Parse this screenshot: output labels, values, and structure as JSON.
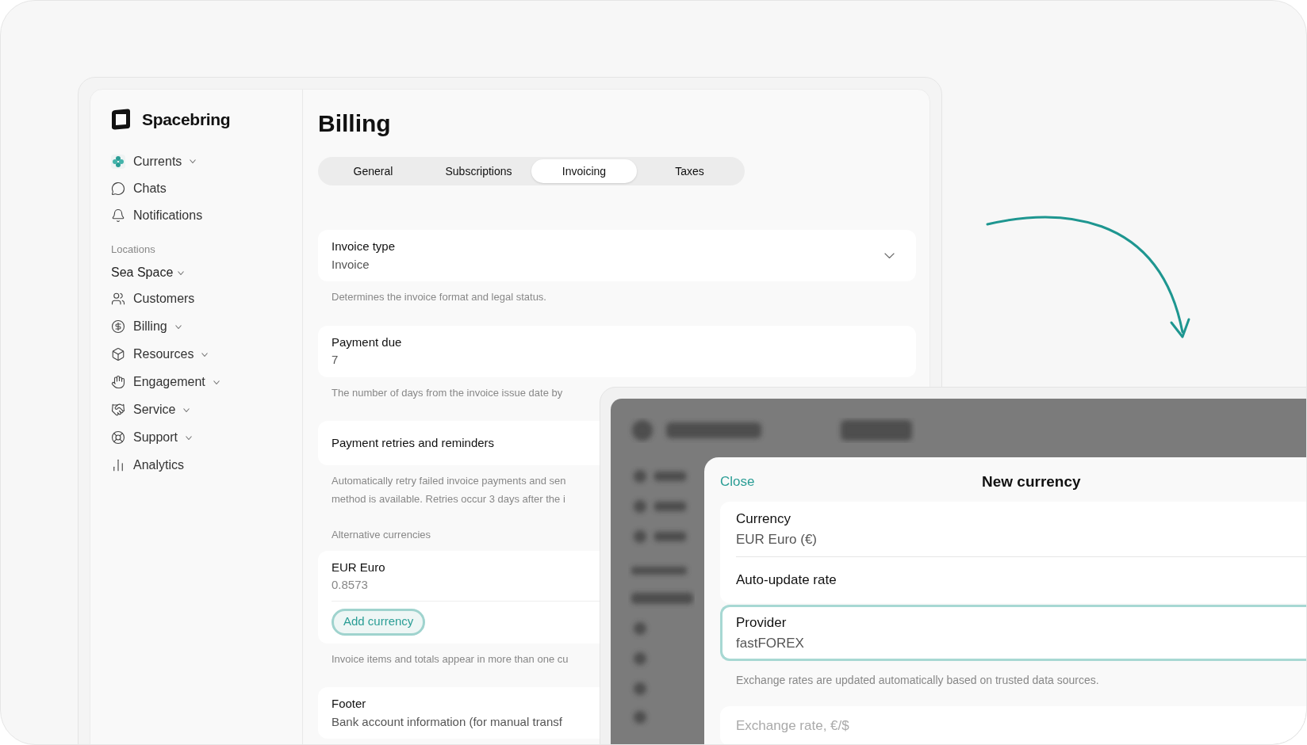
{
  "sidebar": {
    "brand": "Spacebring",
    "top_items": [
      {
        "label": "Currents",
        "dropdown": true
      },
      {
        "label": "Chats",
        "dropdown": false
      },
      {
        "label": "Notifications",
        "dropdown": false
      }
    ],
    "section_label": "Locations",
    "location": {
      "label": "Sea Space",
      "dropdown": true
    },
    "items": [
      {
        "label": "Customers",
        "dropdown": false
      },
      {
        "label": "Billing",
        "dropdown": true
      },
      {
        "label": "Resources",
        "dropdown": true
      },
      {
        "label": "Engagement",
        "dropdown": true
      },
      {
        "label": "Service",
        "dropdown": true
      },
      {
        "label": "Support",
        "dropdown": true
      },
      {
        "label": "Analytics",
        "dropdown": false
      }
    ]
  },
  "page_title": "Billing",
  "tabs": [
    {
      "label": "General",
      "selected": false
    },
    {
      "label": "Subscriptions",
      "selected": false
    },
    {
      "label": "Invoicing",
      "selected": true
    },
    {
      "label": "Taxes",
      "selected": false
    }
  ],
  "sections": [
    {
      "kind": "select",
      "label": "Invoice type",
      "value": "Invoice",
      "description": [
        "Determines the invoice format and legal status."
      ]
    },
    {
      "kind": "field",
      "label": "Payment due",
      "value": "7",
      "description": [
        "The number of days from the invoice issue date by"
      ]
    },
    {
      "kind": "row",
      "label": "Payment retries and reminders",
      "description": [
        "Automatically retry failed invoice payments and sen",
        "method is available. Retries occur 3 days after the i"
      ]
    },
    {
      "kind": "currencies",
      "heading": "Alternative currencies",
      "items": [
        {
          "name": "EUR Euro",
          "value": "0.8573"
        }
      ],
      "button": "Add currency",
      "description": [
        "Invoice items and totals appear in more than one cu"
      ]
    },
    {
      "kind": "field",
      "label": "Footer",
      "value": "Bank account information (for manual transf"
    }
  ],
  "modal": {
    "close": "Close",
    "title": "New currency",
    "currency": {
      "label": "Currency",
      "value": "EUR Euro (€)"
    },
    "auto_update": {
      "label": "Auto-update rate"
    },
    "provider": {
      "label": "Provider",
      "value": "fastFOREX",
      "focused": true
    },
    "helper": "Exchange rates are updated automatically based on trusted data sources.",
    "exchange_rate": {
      "placeholder": "Exchange rate, €/$"
    }
  }
}
